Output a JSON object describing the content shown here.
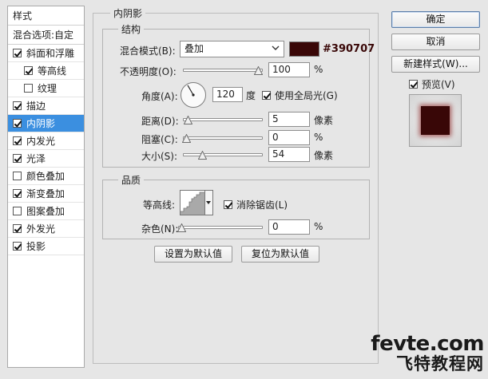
{
  "sidebar": {
    "header": "样式",
    "blend_options": "混合选项:自定",
    "items": [
      {
        "label": "斜面和浮雕",
        "checked": true,
        "sub": false,
        "selected": false
      },
      {
        "label": "等高线",
        "checked": true,
        "sub": true,
        "selected": false
      },
      {
        "label": "纹理",
        "checked": false,
        "sub": true,
        "selected": false
      },
      {
        "label": "描边",
        "checked": true,
        "sub": false,
        "selected": false
      },
      {
        "label": "内阴影",
        "checked": true,
        "sub": false,
        "selected": true
      },
      {
        "label": "内发光",
        "checked": true,
        "sub": false,
        "selected": false
      },
      {
        "label": "光泽",
        "checked": true,
        "sub": false,
        "selected": false
      },
      {
        "label": "颜色叠加",
        "checked": false,
        "sub": false,
        "selected": false
      },
      {
        "label": "渐变叠加",
        "checked": true,
        "sub": false,
        "selected": false
      },
      {
        "label": "图案叠加",
        "checked": false,
        "sub": false,
        "selected": false
      },
      {
        "label": "外发光",
        "checked": true,
        "sub": false,
        "selected": false
      },
      {
        "label": "投影",
        "checked": true,
        "sub": false,
        "selected": false
      }
    ]
  },
  "panel": {
    "title": "内阴影",
    "structure": {
      "title": "结构",
      "blend_mode_label": "混合模式(B):",
      "blend_mode_value": "叠加",
      "color_hex": "#390707",
      "color_label": "#390707",
      "opacity_label": "不透明度(O):",
      "opacity_value": "100",
      "opacity_level": 1.0,
      "percent": "%",
      "angle_label": "角度(A):",
      "angle_value": "120",
      "angle_unit": "度",
      "global_light_label": "使用全局光(G)",
      "global_light_checked": true,
      "distance_label": "距离(D):",
      "distance_value": "5",
      "distance_level": 0.02,
      "choke_label": "阻塞(C):",
      "choke_value": "0",
      "choke_level": 0.0,
      "size_label": "大小(S):",
      "size_value": "54",
      "size_level": 0.22,
      "pixel_unit": "像素"
    },
    "quality": {
      "title": "品质",
      "contour_label": "等高线:",
      "antialias_label": "消除锯齿(L)",
      "antialias_checked": true,
      "noise_label": "杂色(N):",
      "noise_value": "0",
      "noise_level": 0.0
    },
    "set_default": "设置为默认值",
    "reset_default": "复位为默认值"
  },
  "right": {
    "ok": "确定",
    "cancel": "取消",
    "new_style": "新建样式(W)...",
    "preview_label": "预览(V)",
    "preview_checked": true
  },
  "watermark": {
    "line1": "fevte.com",
    "line2": "飞特教程网"
  }
}
